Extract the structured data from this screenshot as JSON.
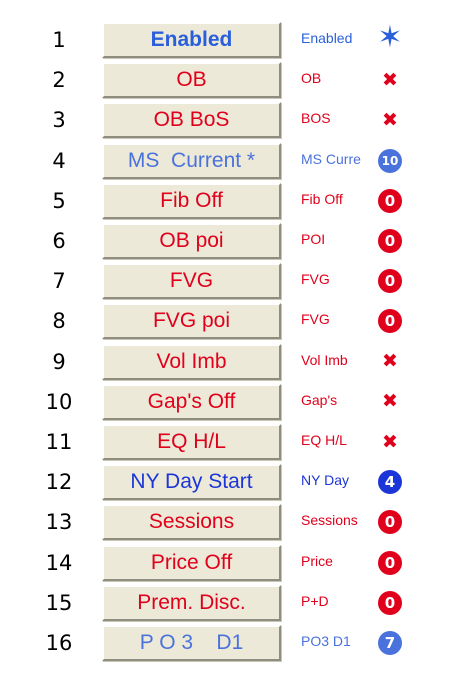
{
  "colors": {
    "red": "#e0001b",
    "blue": "#1c35d8",
    "light_blue": "#4a72dc",
    "enabled_blue": "#2a5fdc"
  },
  "rows": [
    {
      "num": "1",
      "label": "Enabled",
      "status": "Enabled",
      "icon": "star-icon",
      "badge": "",
      "color": "enabled_blue",
      "bold": true
    },
    {
      "num": "2",
      "label": "OB",
      "status": "OB",
      "icon": "x-icon",
      "badge": "",
      "color": "red"
    },
    {
      "num": "3",
      "label": "OB BoS",
      "status": "BOS",
      "icon": "x-icon",
      "badge": "",
      "color": "red"
    },
    {
      "num": "4",
      "label": "MS  Current *",
      "status": "MS Curre",
      "icon": "number-icon",
      "badge": "10",
      "color": "light_blue"
    },
    {
      "num": "5",
      "label": "Fib Off",
      "status": "Fib Off",
      "icon": "zero-icon",
      "badge": "0",
      "color": "red"
    },
    {
      "num": "6",
      "label": "OB poi",
      "status": "POI",
      "icon": "zero-icon",
      "badge": "0",
      "color": "red"
    },
    {
      "num": "7",
      "label": "FVG",
      "status": "FVG",
      "icon": "zero-icon",
      "badge": "0",
      "color": "red"
    },
    {
      "num": "8",
      "label": "FVG poi",
      "status": "FVG",
      "icon": "zero-icon",
      "badge": "0",
      "color": "red"
    },
    {
      "num": "9",
      "label": "Vol Imb",
      "status": "Vol Imb",
      "icon": "x-icon",
      "badge": "",
      "color": "red"
    },
    {
      "num": "10",
      "label": "Gap's Off",
      "status": "Gap's",
      "icon": "x-icon",
      "badge": "",
      "color": "red"
    },
    {
      "num": "11",
      "label": "EQ H/L",
      "status": "EQ H/L",
      "icon": "x-icon",
      "badge": "",
      "color": "red"
    },
    {
      "num": "12",
      "label": "NY Day Start",
      "status": "NY Day",
      "icon": "number-icon",
      "badge": "4",
      "color": "blue"
    },
    {
      "num": "13",
      "label": "Sessions",
      "status": "Sessions",
      "icon": "zero-icon",
      "badge": "0",
      "color": "red"
    },
    {
      "num": "14",
      "label": "Price Off",
      "status": "Price",
      "icon": "zero-icon",
      "badge": "0",
      "color": "red"
    },
    {
      "num": "15",
      "label": "Prem. Disc.",
      "status": "P+D",
      "icon": "zero-icon",
      "badge": "0",
      "color": "red"
    },
    {
      "num": "16",
      "label": "P O 3    D1",
      "status": "PO3 D1",
      "icon": "number-icon",
      "badge": "7",
      "color": "light_blue"
    }
  ]
}
